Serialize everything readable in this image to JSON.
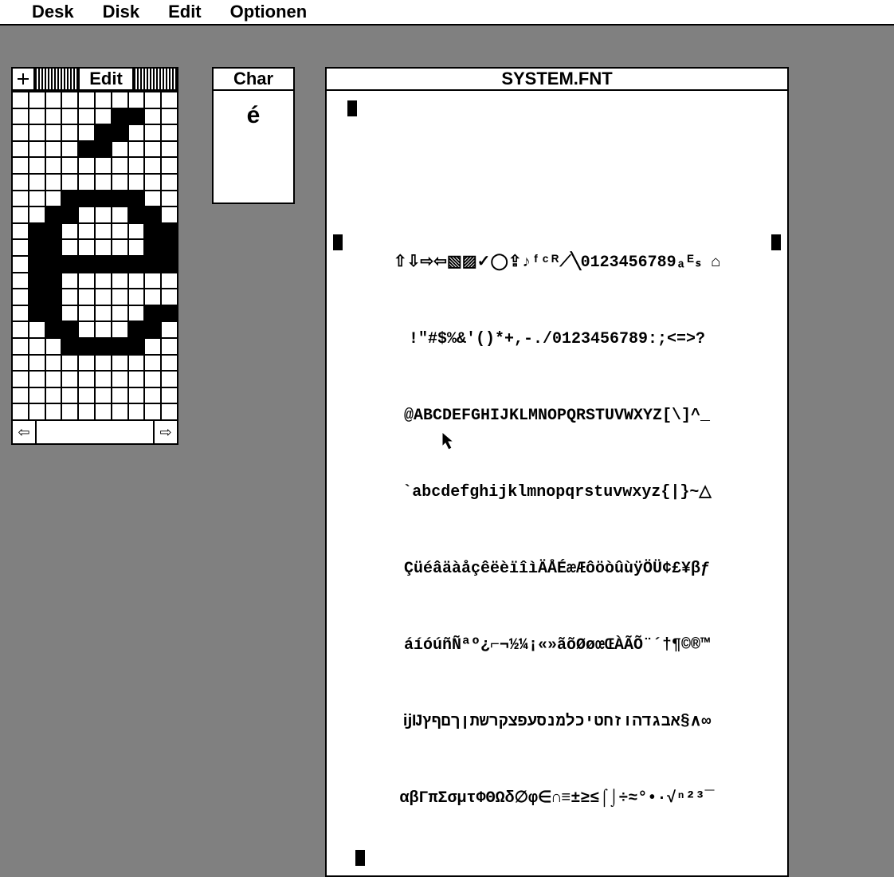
{
  "menubar": {
    "items": [
      "Desk",
      "Disk",
      "Edit",
      "Optionen"
    ]
  },
  "edit_window": {
    "title": "Edit",
    "cols": 10,
    "rows": 20,
    "pixels": [
      [
        0,
        0,
        0,
        0,
        0,
        0,
        0,
        0,
        0,
        0
      ],
      [
        0,
        0,
        0,
        0,
        0,
        0,
        1,
        1,
        0,
        0
      ],
      [
        0,
        0,
        0,
        0,
        0,
        1,
        1,
        0,
        0,
        0
      ],
      [
        0,
        0,
        0,
        0,
        1,
        1,
        0,
        0,
        0,
        0
      ],
      [
        0,
        0,
        0,
        0,
        0,
        0,
        0,
        0,
        0,
        0
      ],
      [
        0,
        0,
        0,
        0,
        0,
        0,
        0,
        0,
        0,
        0
      ],
      [
        0,
        0,
        0,
        1,
        1,
        1,
        1,
        1,
        0,
        0
      ],
      [
        0,
        0,
        1,
        1,
        0,
        0,
        0,
        1,
        1,
        0
      ],
      [
        0,
        1,
        1,
        0,
        0,
        0,
        0,
        0,
        1,
        1
      ],
      [
        0,
        1,
        1,
        0,
        0,
        0,
        0,
        0,
        1,
        1
      ],
      [
        0,
        1,
        1,
        1,
        1,
        1,
        1,
        1,
        1,
        1
      ],
      [
        0,
        1,
        1,
        0,
        0,
        0,
        0,
        0,
        0,
        0
      ],
      [
        0,
        1,
        1,
        0,
        0,
        0,
        0,
        0,
        0,
        0
      ],
      [
        0,
        1,
        1,
        0,
        0,
        0,
        0,
        0,
        1,
        1
      ],
      [
        0,
        0,
        1,
        1,
        0,
        0,
        0,
        1,
        1,
        0
      ],
      [
        0,
        0,
        0,
        1,
        1,
        1,
        1,
        1,
        0,
        0
      ],
      [
        0,
        0,
        0,
        0,
        0,
        0,
        0,
        0,
        0,
        0
      ],
      [
        0,
        0,
        0,
        0,
        0,
        0,
        0,
        0,
        0,
        0
      ],
      [
        0,
        0,
        0,
        0,
        0,
        0,
        0,
        0,
        0,
        0
      ],
      [
        0,
        0,
        0,
        0,
        0,
        0,
        0,
        0,
        0,
        0
      ]
    ],
    "scroll_left": "⇦",
    "scroll_right": "⇨"
  },
  "char_window": {
    "title": "Char",
    "glyph": "é"
  },
  "fnt_window": {
    "title": "SYSTEM.FNT",
    "lines": [
      "⇧⇩⇨⇦▧▨✓◯⇪♪ᶠᶜᴿ⟋╲0123456789ₐᴱₛ ⌂",
      "!\"#$%&'()*+,-./0123456789:;<=>?",
      "@ABCDEFGHIJKLMNOPQRSTUVWXYZ[\\]^_",
      "`abcdefghijklmnopqrstuvwxyz{|}~△",
      "ÇüéâäàåçêëèïîìÄÅÉæÆôöòûùÿÖÜ¢£¥βƒ",
      "áíóúñÑªº¿⌐¬½¼¡«»ãõØøœŒÀÃÕ¨´†¶©®™",
      "ĳĲאבגדהוזחטיכלמנסעפצקרשתןךםףץ§∧∞",
      "αβΓπΣσμτΦΘΩδ∅φ∈∩≡±≥≤⌠⌡÷≈°•·√ⁿ²³¯"
    ]
  }
}
